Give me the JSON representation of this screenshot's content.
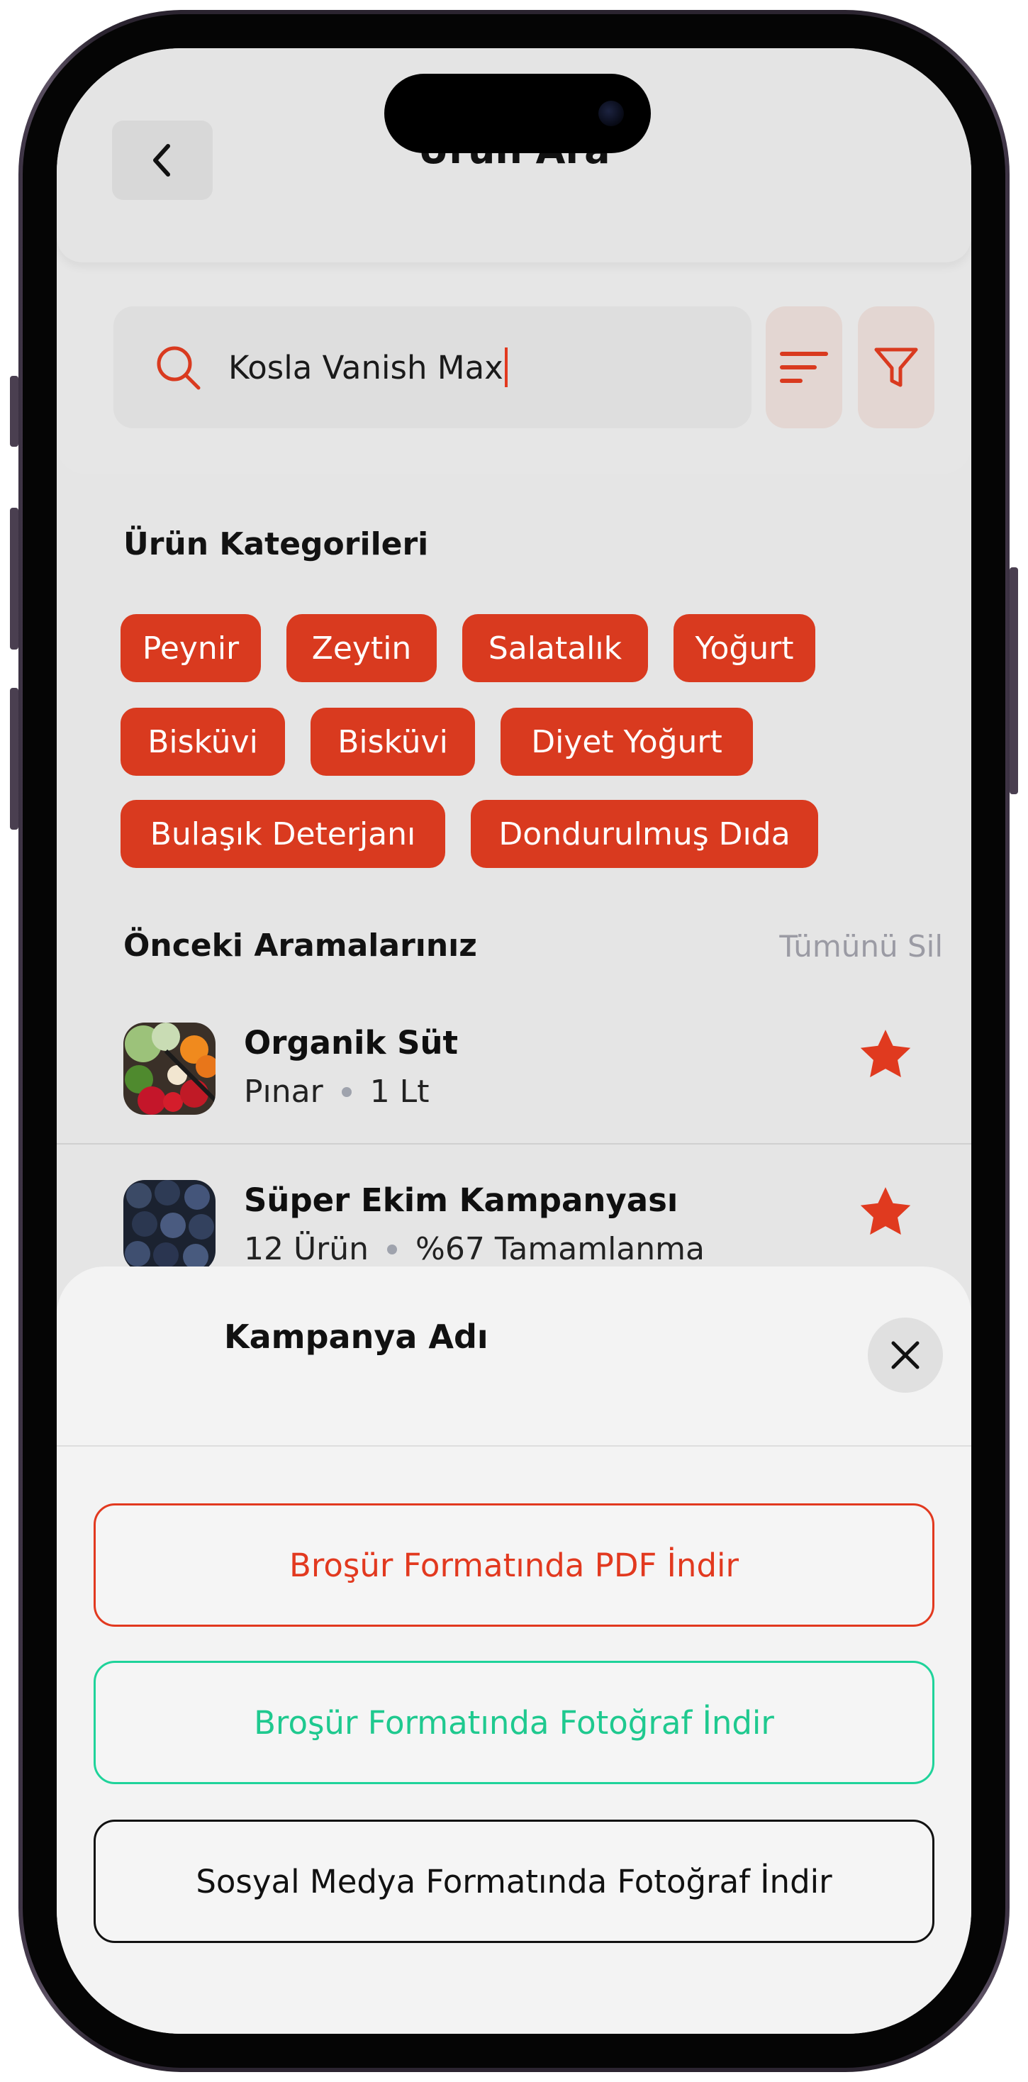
{
  "header": {
    "title": "Ürün Ara",
    "back_icon": "chevron-left-icon"
  },
  "search": {
    "value": "Kosla Vanish Max",
    "icon": "search-icon"
  },
  "toolbar": {
    "sort_icon": "sort-lines-icon",
    "filter_icon": "filter-funnel-icon"
  },
  "categories": {
    "title": "Ürün Kategorileri",
    "items": [
      "Peynir",
      "Zeytin",
      "Salatalık",
      "Yoğurt",
      "Bisküvi",
      "Bisküvi",
      "Diyet Yoğurt",
      "Bulaşık Deterjanı",
      "Dondurulmuş Dıda"
    ]
  },
  "recent": {
    "title": "Önceki Aramalarınız",
    "clear_label": "Tümünü Sil",
    "items": [
      {
        "name": "Organik Süt",
        "meta_a": "Pınar",
        "meta_b": "1 Lt",
        "thumb": "vegetables-image"
      },
      {
        "name": "Süper Ekim Kampanyası",
        "meta_a": "12 Ürün",
        "meta_b": "%67 Tamamlanma",
        "thumb": "blueberries-image"
      }
    ]
  },
  "sheet": {
    "title": "Kampanya Adı",
    "buttons": [
      {
        "label": "Broşür Formatında PDF İndir",
        "color": "#e2391f"
      },
      {
        "label": "Broşür Formatında Fotoğraf İndir",
        "color": "#1fd39a"
      },
      {
        "label": "Sosyal Medya Formatında Fotoğraf İndir",
        "color": "#111111"
      }
    ]
  },
  "colors": {
    "accent": "#d93a1f",
    "background": "#e5e5e5",
    "sheet": "#f3f3f3"
  }
}
